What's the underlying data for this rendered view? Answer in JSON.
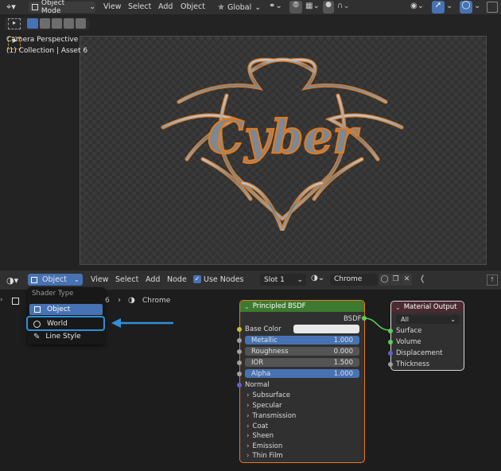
{
  "header": {
    "mode": "Object Mode",
    "menu": [
      "View",
      "Select",
      "Add",
      "Object"
    ],
    "orientation": "Global"
  },
  "viewport": {
    "view_name": "Camera Perspective",
    "collection": "(1) Collection | Asset 6",
    "logo_text": "Cyber"
  },
  "shader_header": {
    "object_dropdown": "Object",
    "menu": [
      "View",
      "Select",
      "Add",
      "Node"
    ],
    "use_nodes_label": "Use Nodes",
    "use_nodes_checked": true,
    "slot": "Slot 1",
    "material_name": "Chrome"
  },
  "breadcrumb": {
    "partial": "6",
    "material": "Chrome"
  },
  "shader_type_menu": {
    "title": "Shader Type",
    "items": [
      {
        "label": "Object",
        "icon": "object-icon",
        "selected": true
      },
      {
        "label": "World",
        "icon": "world-icon",
        "highlighted": true
      },
      {
        "label": "Line Style",
        "icon": "line-style-icon"
      }
    ]
  },
  "principled_bsdf": {
    "title": "Principled BSDF",
    "output": "BSDF",
    "base_color_label": "Base Color",
    "fields": [
      {
        "label": "Metallic",
        "value": "1.000",
        "fill": 1.0
      },
      {
        "label": "Roughness",
        "value": "0.000",
        "fill": 0.0
      },
      {
        "label": "IOR",
        "value": "1.500",
        "fill": 0.0
      },
      {
        "label": "Alpha",
        "value": "1.000",
        "fill": 1.0
      }
    ],
    "normal_label": "Normal",
    "panels": [
      "Subsurface",
      "Specular",
      "Transmission",
      "Coat",
      "Sheen",
      "Emission",
      "Thin Film"
    ]
  },
  "material_output": {
    "title": "Material Output",
    "target": "All",
    "inputs": [
      "Surface",
      "Volume",
      "Displacement",
      "Thickness"
    ]
  },
  "colors": {
    "accent": "#4772b3",
    "highlight_box": "#2f8fd8",
    "shader_node_header": "#3c7a2f",
    "output_node_header": "#4b2a33",
    "node_body": "#303030",
    "socket_shader": "#5ccf5c",
    "socket_float": "#a1a1a1",
    "socket_color": "#c7c729",
    "socket_vector": "#6363c7"
  }
}
